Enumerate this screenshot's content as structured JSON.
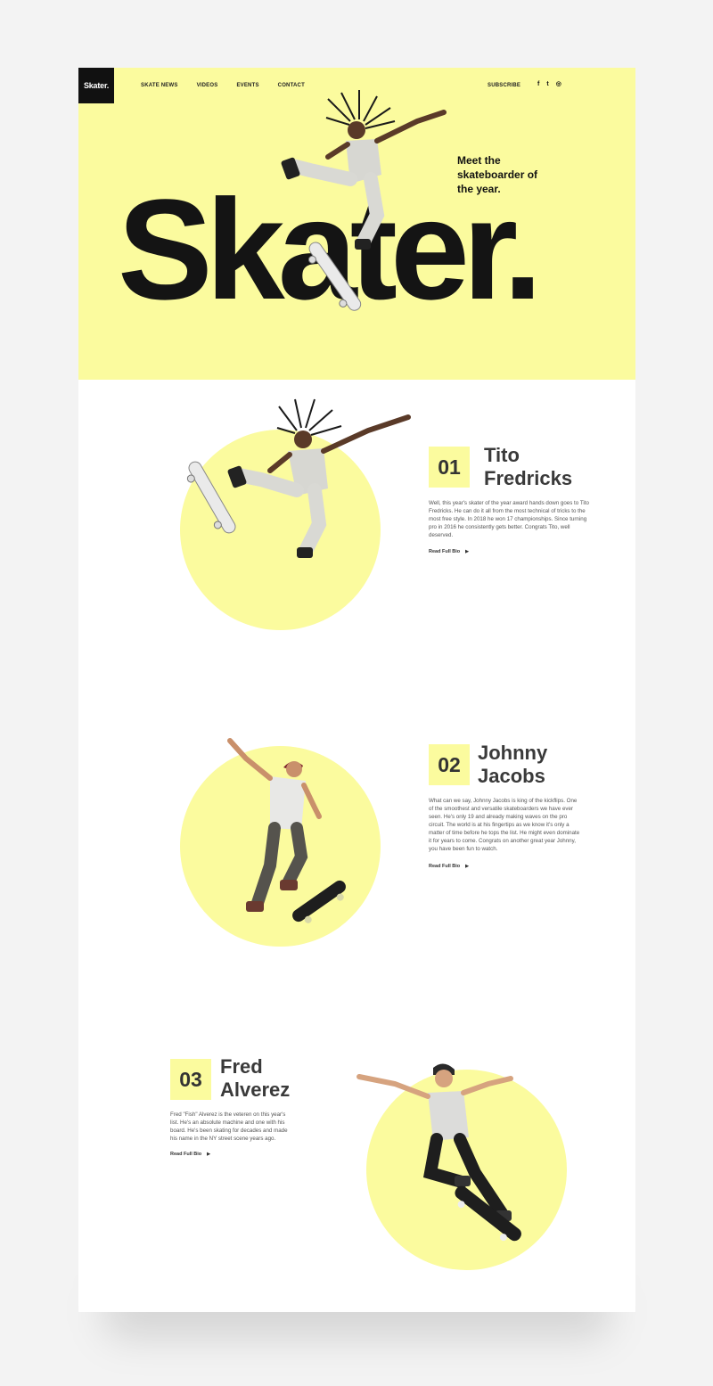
{
  "header": {
    "logo": "Skater.",
    "nav": [
      "SKATE NEWS",
      "VIDEOS",
      "EVENTS",
      "CONTACT"
    ],
    "subscribe": "SUBSCRIBE",
    "social_icons": [
      "facebook-icon",
      "twitter-icon",
      "instagram-icon"
    ],
    "social_glyphs": [
      "f",
      "t",
      "◎"
    ]
  },
  "hero": {
    "title": "Skater.",
    "tagline": "Meet the skateboarder of the year."
  },
  "colors": {
    "accent_yellow": "#fbfb9e",
    "ink": "#141414",
    "page_bg": "#f3f3f3"
  },
  "skaters": [
    {
      "number": "01",
      "name": "Tito Fredricks",
      "bio": "Well, this year's skater of the year award hands down goes to Tito Fredricks.  He can do it all from the most technical of tricks to the most free style.  In 2018 he won 17 championships.  Since turning pro in 2016 he consistently gets better.  Congrats Tito, well deserved.",
      "link": "Read Full Bio"
    },
    {
      "number": "02",
      "name": "Johnny Jacobs",
      "bio": "What can we say, Johnny Jacobs is king of the kickflips. One of the smoothest and versatile skateboarders we have ever seen.  He's only 19 and already making waves on the pro circuit.  The world is at his fingertips as we know it's only a matter of time before he tops the list.  He might even dominate it for years to come.  Congrats on another great year Johnny, you have been fun to watch.",
      "link": "Read Full Bio"
    },
    {
      "number": "03",
      "name": "Fred Alverez",
      "bio": "Fred \"Fish\" Alverez is the veteren on this year's list.  He's an absolute machine and one with his board.  He's been skating for decades and made his name in the NY street scene years ago.",
      "link": "Read Full Bio"
    }
  ]
}
